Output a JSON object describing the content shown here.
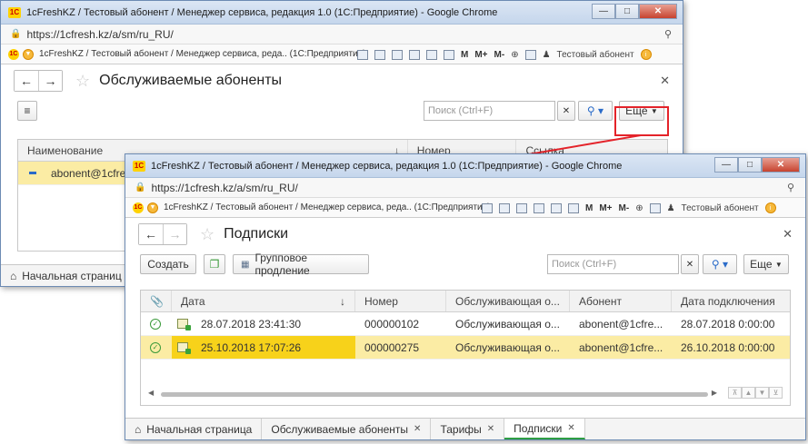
{
  "window1": {
    "title": "1cFreshKZ / Тестовый абонент / Менеджер сервиса, редакция 1.0 (1С:Предприятие) - Google Chrome",
    "url": "https://1cfresh.kz/a/sm/ru_RU/",
    "app_title": "1cFreshKZ / Тестовый абонент / Менеджер сервиса, реда.. (1С:Предприятие)",
    "user": "Тестовый абонент",
    "form_title": "Обслуживаемые абоненты",
    "search_placeholder": "Поиск (Ctrl+F)",
    "more_label": "Еще",
    "columns": [
      "Наименование",
      "Номер",
      "Ссылка"
    ],
    "rows": [
      {
        "name": "abonent@1cfre"
      }
    ],
    "home_tab": "Начальная страниц"
  },
  "window2": {
    "title": "1cFreshKZ / Тестовый абонент / Менеджер сервиса, редакция 1.0 (1С:Предприятие) - Google Chrome",
    "url": "https://1cfresh.kz/a/sm/ru_RU/",
    "app_title": "1cFreshKZ / Тестовый абонент / Менеджер сервиса, реда.. (1С:Предприятие)",
    "user": "Тестовый абонент",
    "form_title": "Подписки",
    "create_label": "Создать",
    "group_renew_label": "Групповое продление",
    "search_placeholder": "Поиск (Ctrl+F)",
    "more_label": "Еще",
    "columns": [
      "Дата",
      "Номер",
      "Обслуживающая о...",
      "Абонент",
      "Дата подключения"
    ],
    "rows": [
      {
        "date": "28.07.2018 23:41:30",
        "number": "000000102",
        "org": "Обслуживающая о...",
        "subscriber": "abonent@1cfre...",
        "connected": "28.07.2018 0:00:00"
      },
      {
        "date": "25.10.2018 17:07:26",
        "number": "000000275",
        "org": "Обслуживающая о...",
        "subscriber": "abonent@1cfre...",
        "connected": "26.10.2018 0:00:00"
      }
    ],
    "tabs": [
      {
        "label": "Начальная страница"
      },
      {
        "label": "Обслуживаемые абоненты"
      },
      {
        "label": "Тарифы"
      },
      {
        "label": "Подписки"
      }
    ]
  },
  "toolbar_glyphs": {
    "m": "M",
    "mplus": "M+",
    "mminus": "M-"
  },
  "colors": {
    "accent_highlight": "#e4232a",
    "selected_row": "#fbeca4",
    "cursor_cell": "#f7d21a"
  }
}
